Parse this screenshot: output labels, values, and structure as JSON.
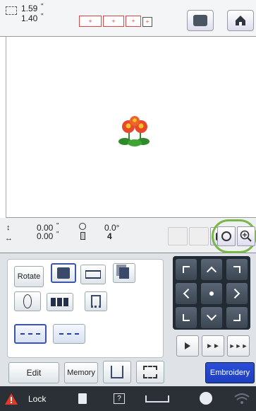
{
  "status": {
    "width": "1.59",
    "height": "1.40",
    "unit": "\""
  },
  "adjust": {
    "x": "0.00",
    "y": "0.00",
    "unit": "\"",
    "rotation": "0.0°",
    "thread_changes": "4"
  },
  "edit_panel": {
    "rotate_label": "Rotate"
  },
  "bottom": {
    "edit_label": "Edit",
    "memory_label": "Memory",
    "embroidery_label": "Embroidery"
  },
  "footer": {
    "lock_label": "Lock"
  },
  "colors": {
    "accent": "#1e3fc0",
    "footer_bg": "#2b2f36",
    "highlight_circle": "#7ab648",
    "lock_red": "#e23a2a"
  }
}
